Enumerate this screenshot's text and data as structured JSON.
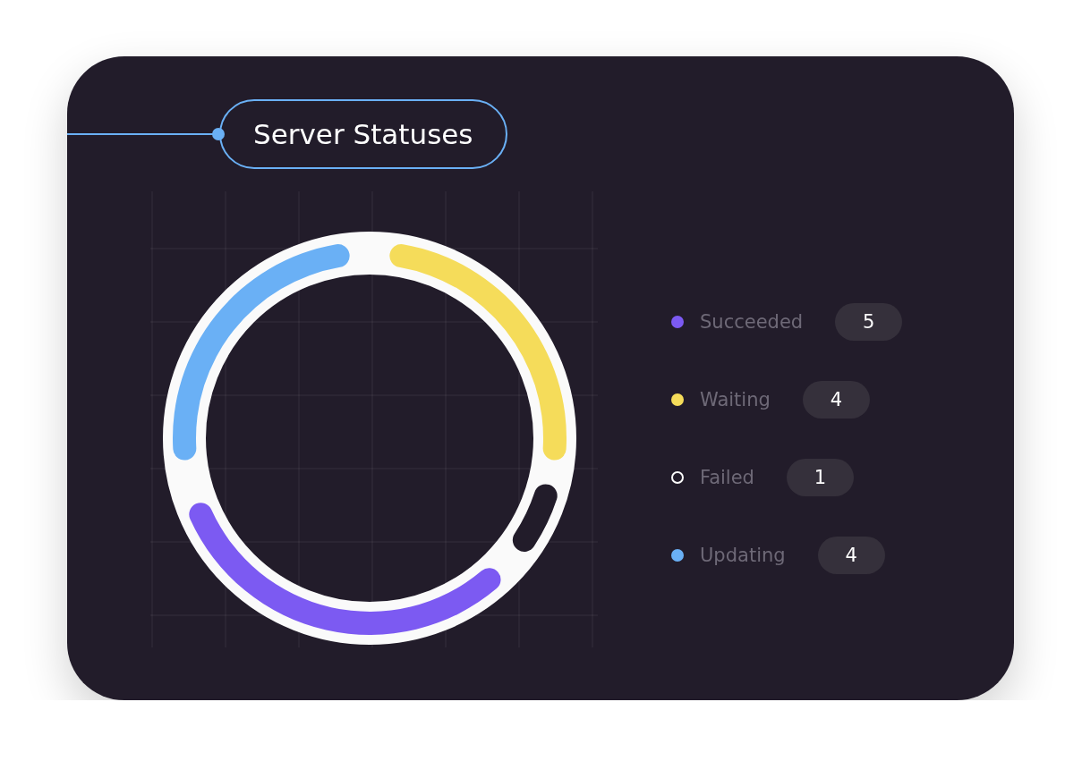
{
  "card": {
    "title": "Server Statuses"
  },
  "chart": {
    "chart_data": {
      "type": "donut",
      "values": [
        28.6,
        7.1,
        35.7,
        28.6
      ],
      "colors": [
        "#f5dc5a",
        "#221c2a",
        "#7c5af2",
        "#6ab0f5"
      ]
    }
  },
  "legend": {
    "items": [
      {
        "label": "Succeeded",
        "count": "5",
        "color": "#7c5af2"
      },
      {
        "label": "Waiting",
        "count": "4",
        "color": "#f5dc5a"
      },
      {
        "label": "Failed",
        "count": "1",
        "color": "#221c2a"
      },
      {
        "label": "Updating",
        "count": "4",
        "color": "#6ab0f5"
      }
    ]
  }
}
